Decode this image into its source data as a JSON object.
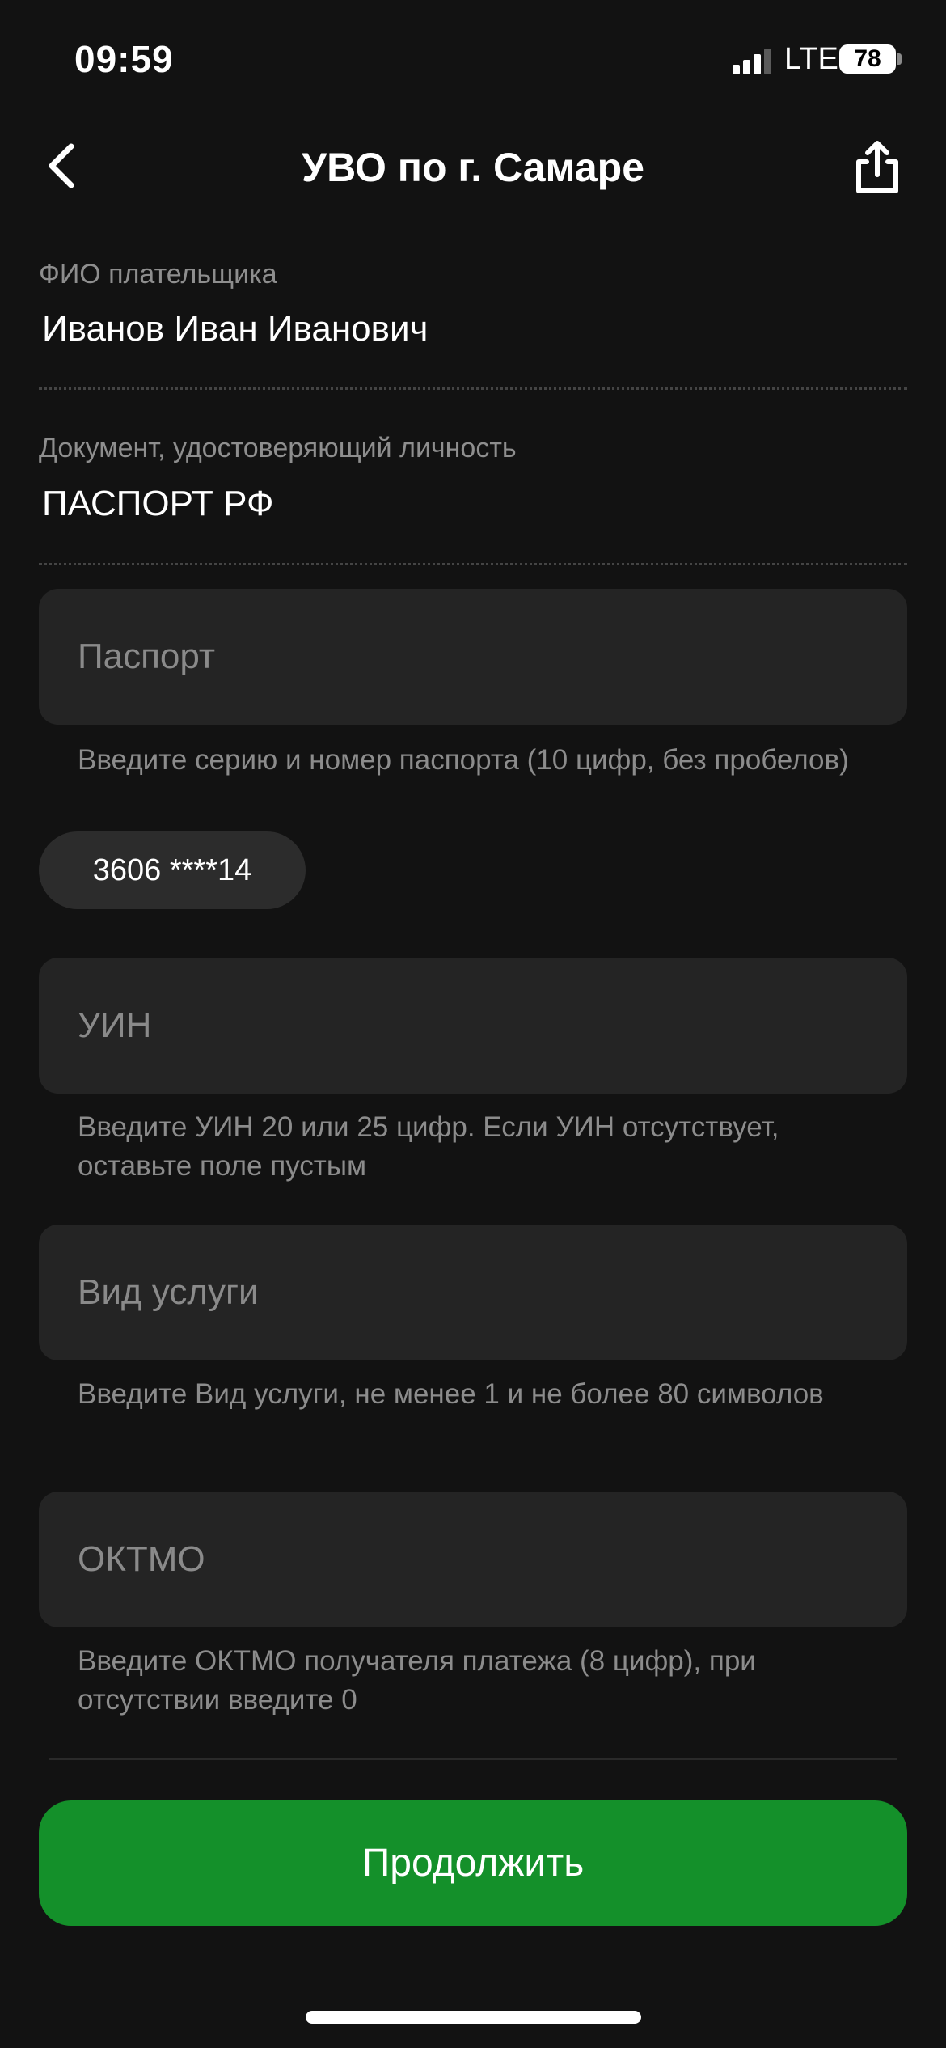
{
  "status_bar": {
    "time": "09:59",
    "network": "LTE",
    "battery": "78",
    "icons": [
      "signal-icon",
      "battery-icon"
    ]
  },
  "header": {
    "title": "УВО по г. Самаре",
    "back_icon": "chevron-left-icon",
    "share_icon": "share-icon"
  },
  "payer": {
    "label": "ФИО плательщика",
    "value": "Иванов Иван Иванович"
  },
  "document": {
    "label": "Документ, удостоверяющий личность",
    "value": "ПАСПОРТ РФ"
  },
  "fields": {
    "passport": {
      "placeholder": "Паспорт",
      "hint": "Введите серию и номер паспорта (10 цифр, без пробелов)",
      "suggestion": "3606 ****14"
    },
    "uin": {
      "placeholder": "УИН",
      "hint": "Введите УИН 20 или 25 цифр. Если УИН отсутствует, оставьте поле пустым"
    },
    "service": {
      "placeholder": "Вид услуги",
      "hint": "Введите Вид услуги, не менее 1 и не более 80 символов"
    },
    "oktmo": {
      "placeholder": "ОКТМО",
      "hint": "Введите ОКТМО получателя платежа (8 цифр), при отсутствии введите 0"
    }
  },
  "actions": {
    "continue_label": "Продолжить"
  },
  "colors": {
    "background": "#121212",
    "field": "#242424",
    "accent": "#14902a"
  }
}
